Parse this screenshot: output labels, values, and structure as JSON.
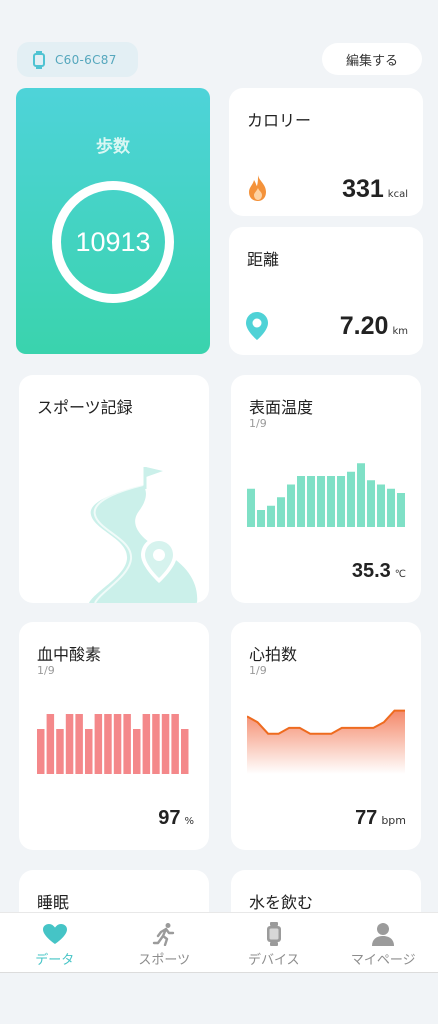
{
  "header": {
    "device_name": "C60-6C87",
    "edit_label": "編集する"
  },
  "steps": {
    "title": "歩数",
    "value": "10913"
  },
  "calorie": {
    "title": "カロリー",
    "value": "331",
    "unit": "kcal"
  },
  "distance": {
    "title": "距離",
    "value": "7.20",
    "unit": "km"
  },
  "sports_record": {
    "title": "スポーツ記録"
  },
  "surface_temp": {
    "title": "表面温度",
    "page": "1/9",
    "value": "35.3",
    "unit": "℃",
    "bars": [
      34.8,
      34.3,
      34.4,
      34.6,
      34.9,
      35.1,
      35.1,
      35.1,
      35.1,
      35.1,
      35.2,
      35.4,
      35.0,
      34.9,
      34.8,
      34.7
    ]
  },
  "blood_oxygen": {
    "title": "血中酸素",
    "page": "1/9",
    "value": "97",
    "unit": "%",
    "bars": [
      96,
      97,
      96,
      97,
      97,
      96,
      97,
      97,
      97,
      97,
      96,
      97,
      97,
      97,
      97,
      96
    ]
  },
  "heart_rate": {
    "title": "心拍数",
    "page": "1/9",
    "value": "77",
    "unit": "bpm",
    "series": [
      80,
      79,
      77,
      77,
      78,
      78,
      77,
      77,
      77,
      78,
      78,
      78,
      78,
      79,
      81,
      81
    ]
  },
  "sleep": {
    "title": "睡眠"
  },
  "water": {
    "title": "水を飲む"
  },
  "tabs": [
    {
      "label": "データ",
      "icon": "heart-icon",
      "active": true
    },
    {
      "label": "スポーツ",
      "icon": "running-icon",
      "active": false
    },
    {
      "label": "デバイス",
      "icon": "watch-icon",
      "active": false
    },
    {
      "label": "マイページ",
      "icon": "person-icon",
      "active": false
    }
  ],
  "colors": {
    "teal": "#45c4c6",
    "temp_bar": "#7fe0c6",
    "oxygen_bar": "#f4888a",
    "heart_line": "#ee6b1f",
    "calorie_icon": "#f4923a",
    "distance_icon": "#4fd2d6"
  }
}
